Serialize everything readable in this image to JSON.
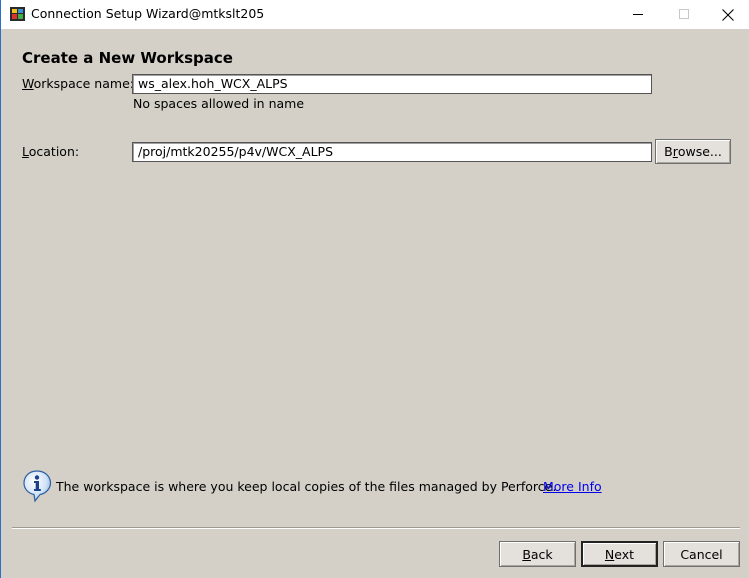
{
  "window": {
    "title": "Connection Setup Wizard@mtkslt205",
    "icon": "app-icon",
    "controls": {
      "minimize": "minimize-icon",
      "maximize": "maximize-icon",
      "close": "close-icon"
    }
  },
  "page": {
    "heading": "Create a New Workspace"
  },
  "workspace": {
    "label_mnemonic": "W",
    "label_rest": "orkspace name:",
    "value": "ws_alex.hoh_WCX_ALPS",
    "hint": "No spaces allowed in name"
  },
  "location": {
    "label_mnemonic": "L",
    "label_rest": "ocation:",
    "value": "/proj/mtk20255/p4v/WCX_ALPS",
    "browse_pre": "B",
    "browse_mnemonic": "r",
    "browse_post": "owse..."
  },
  "info": {
    "icon": "info-icon",
    "text": "The workspace is where you keep local copies of the files managed by Perforce.",
    "link": "More Info"
  },
  "footer": {
    "back_mnemonic": "B",
    "back_rest": "ack",
    "next_mnemonic": "N",
    "next_rest": "ext",
    "cancel": "Cancel"
  }
}
